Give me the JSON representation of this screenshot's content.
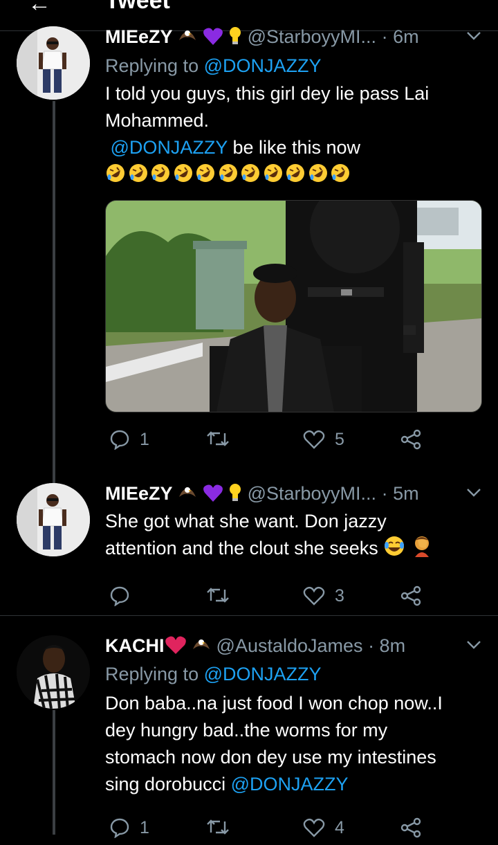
{
  "top_bar": {
    "title": "Tweet",
    "back_glyph": "←"
  },
  "tweets": [
    {
      "display_name": "MIEeZY",
      "name_emojis": [
        "eagle-icon",
        "purple-heart-icon",
        "light-bulb-icon"
      ],
      "handle": "@StarboyyMI...",
      "time": "· 6m",
      "replying_prefix": "Replying to",
      "replying_to": "@DONJAZZY",
      "text_line1": "I told you guys, this girl dey lie pass Lai",
      "text_line2": "Mohammed.",
      "text_line3_mention": "@DONJAZZY",
      "text_line3_rest": " be like this now",
      "laugh_emoji_count": 11,
      "reply_count": "1",
      "retweet_count": "",
      "like_count": "5"
    },
    {
      "display_name": "MIEeZY",
      "name_emojis": [
        "eagle-icon",
        "purple-heart-icon",
        "light-bulb-icon"
      ],
      "handle": "@StarboyyMI...",
      "time": "· 5m",
      "text_line1": "She got what she want. Don jazzy",
      "text_line2": "attention and the clout she seeks",
      "reply_count": "",
      "retweet_count": "",
      "like_count": "3"
    },
    {
      "display_name": "KACHI",
      "name_emojis": [
        "red-heart-icon",
        "eagle-icon"
      ],
      "handle": "@AustaldoJames",
      "time": "· 8m",
      "replying_prefix": "Replying to",
      "replying_to": "@DONJAZZY",
      "text_line1": "Don baba..na just food I won chop now..I",
      "text_line2": "dey hungry bad..the worms for my",
      "text_line3": "stomach now don dey use my intestines",
      "text_line4": "sing dorobucci ",
      "text_line4_mention": "@DONJAZZY",
      "reply_count": "1",
      "retweet_count": "",
      "like_count": "4"
    }
  ],
  "colors": {
    "background": "#000000",
    "secondary_text": "#8899a6",
    "mention": "#1da1f2",
    "divider": "#2f3336"
  }
}
